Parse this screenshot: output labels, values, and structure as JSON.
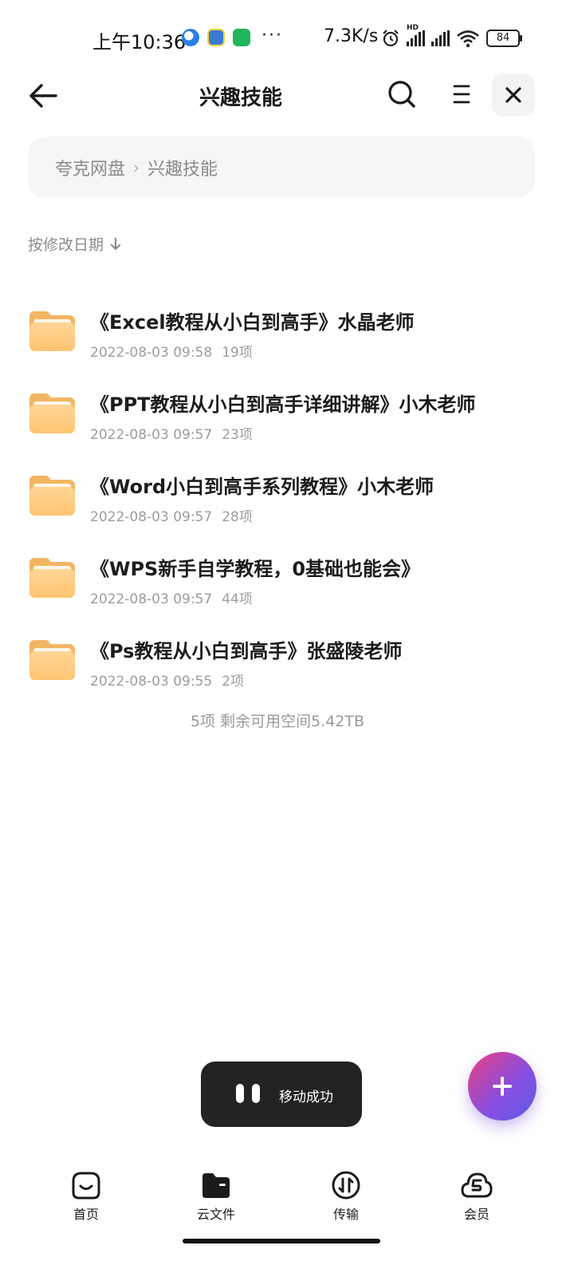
{
  "status_bar": {
    "time": "上午10:36",
    "more": "···",
    "net_speed": "7.3K/s",
    "hd": "HD",
    "battery": "84"
  },
  "header": {
    "title": "兴趣技能"
  },
  "breadcrumb": {
    "root": "夸克网盘",
    "current": "兴趣技能"
  },
  "sort": {
    "label": "按修改日期"
  },
  "files": [
    {
      "name": "《Excel教程从小白到高手》水晶老师",
      "date": "2022-08-03 09:58",
      "count": "19项"
    },
    {
      "name": "《PPT教程从小白到高手详细讲解》小木老师",
      "date": "2022-08-03 09:57",
      "count": "23项"
    },
    {
      "name": "《Word小白到高手系列教程》小木老师",
      "date": "2022-08-03 09:57",
      "count": "28项"
    },
    {
      "name": "《WPS新手自学教程，0基础也能会》",
      "date": "2022-08-03 09:57",
      "count": "44项"
    },
    {
      "name": "《Ps教程从小白到高手》张盛陵老师",
      "date": "2022-08-03 09:55",
      "count": "2项"
    }
  ],
  "summary": "5项 剩余可用空间5.42TB",
  "toast": {
    "text": "移动成功"
  },
  "nav": [
    {
      "label": "首页",
      "icon": "home-icon"
    },
    {
      "label": "云文件",
      "icon": "cloud-files-icon",
      "active": true
    },
    {
      "label": "传输",
      "icon": "transfer-icon"
    },
    {
      "label": "会员",
      "icon": "vip-icon"
    }
  ],
  "colors": {
    "folder": "#ffc472",
    "fab_start": "#ed3f7d",
    "fab_end": "#5a5de8",
    "toast_bg": "#232323"
  }
}
